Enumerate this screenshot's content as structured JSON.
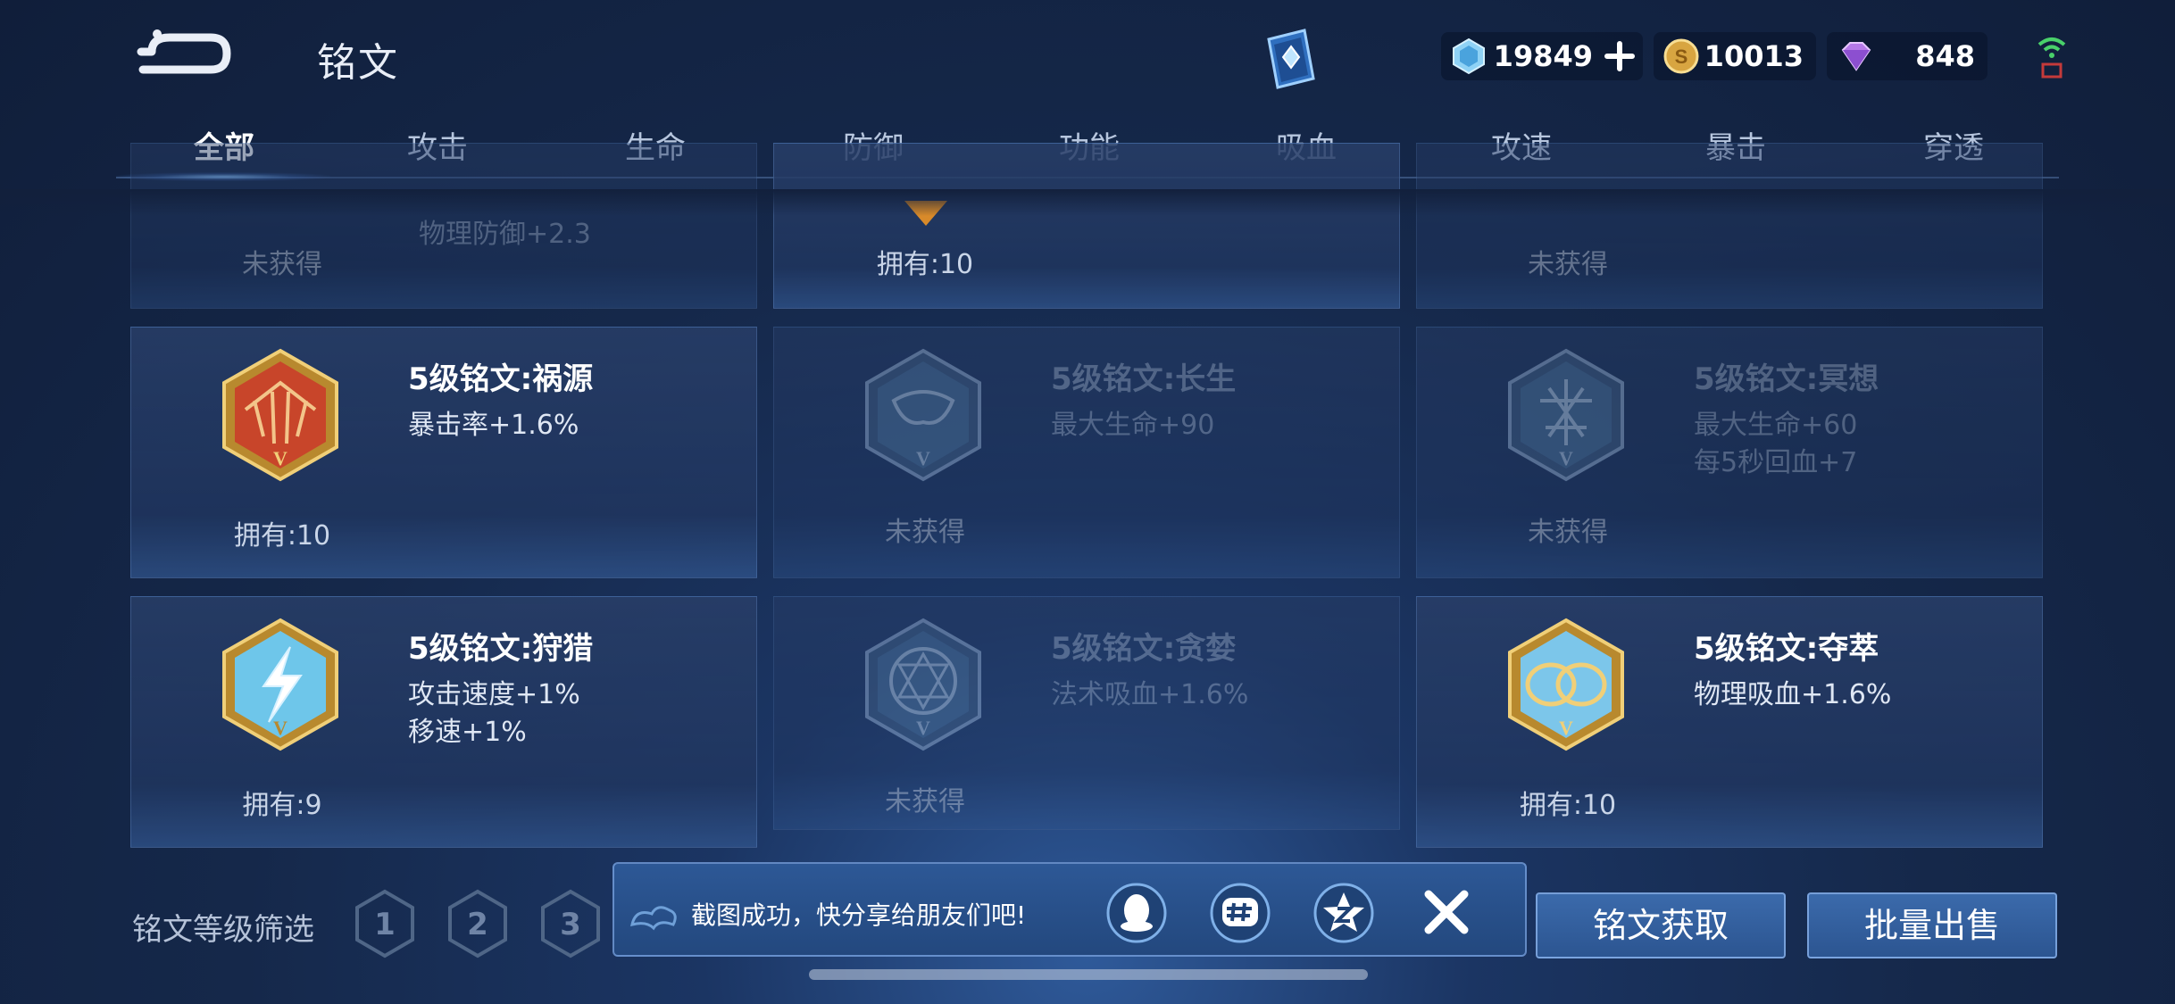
{
  "header": {
    "title": "铭文",
    "currencies": {
      "diamond": "19849",
      "gold": "10013",
      "gem": "848"
    }
  },
  "tabs": [
    "全部",
    "攻击",
    "生命",
    "防御",
    "功能",
    "吸血",
    "攻速",
    "暴击",
    "穿透"
  ],
  "active_tab": "全部",
  "partial_cards": [
    {
      "attr": "物理防御+2.3",
      "status": "未获得"
    },
    {
      "status": "拥有:10"
    },
    {
      "status": "未获得"
    }
  ],
  "cards": [
    {
      "name": "5级铭文:祸源",
      "attrs": [
        "暴击率+1.6%"
      ],
      "status": "拥有:10",
      "owned": true,
      "color": "#c8452a"
    },
    {
      "name": "5级铭文:长生",
      "attrs": [
        "最大生命+90"
      ],
      "status": "未获得",
      "owned": false,
      "color": "#4a6f98"
    },
    {
      "name": "5级铭文:冥想",
      "attrs": [
        "最大生命+60",
        "每5秒回血+7"
      ],
      "status": "未获得",
      "owned": false,
      "color": "#4a6f98"
    },
    {
      "name": "5级铭文:狩猎",
      "attrs": [
        "攻击速度+1%",
        "移速+1%"
      ],
      "status": "拥有:9",
      "owned": true,
      "color": "#6ec6ea"
    },
    {
      "name": "5级铭文:贪婪",
      "attrs": [
        "法术吸血+1.6%"
      ],
      "status": "未获得",
      "owned": false,
      "color": "#4a6f98"
    },
    {
      "name": "5级铭文:夺萃",
      "attrs": [
        "物理吸血+1.6%"
      ],
      "status": "拥有:10",
      "owned": true,
      "color": "#7cc6ea"
    }
  ],
  "bottom": {
    "filter_label": "铭文等级筛选",
    "levels": [
      "1",
      "2",
      "3"
    ],
    "share_text": "截图成功，快分享给朋友们吧!",
    "acquire_label": "铭文获取",
    "sell_label": "批量出售"
  },
  "icons": {
    "back": "back-arrow-icon",
    "codex": "inscription-book-icon",
    "diamond": "diamond-currency-icon",
    "gold": "gold-coin-icon",
    "gem": "purple-gem-icon",
    "share": [
      "qq-icon",
      "moments-icon",
      "qzone-icon"
    ],
    "close": "close-icon"
  }
}
